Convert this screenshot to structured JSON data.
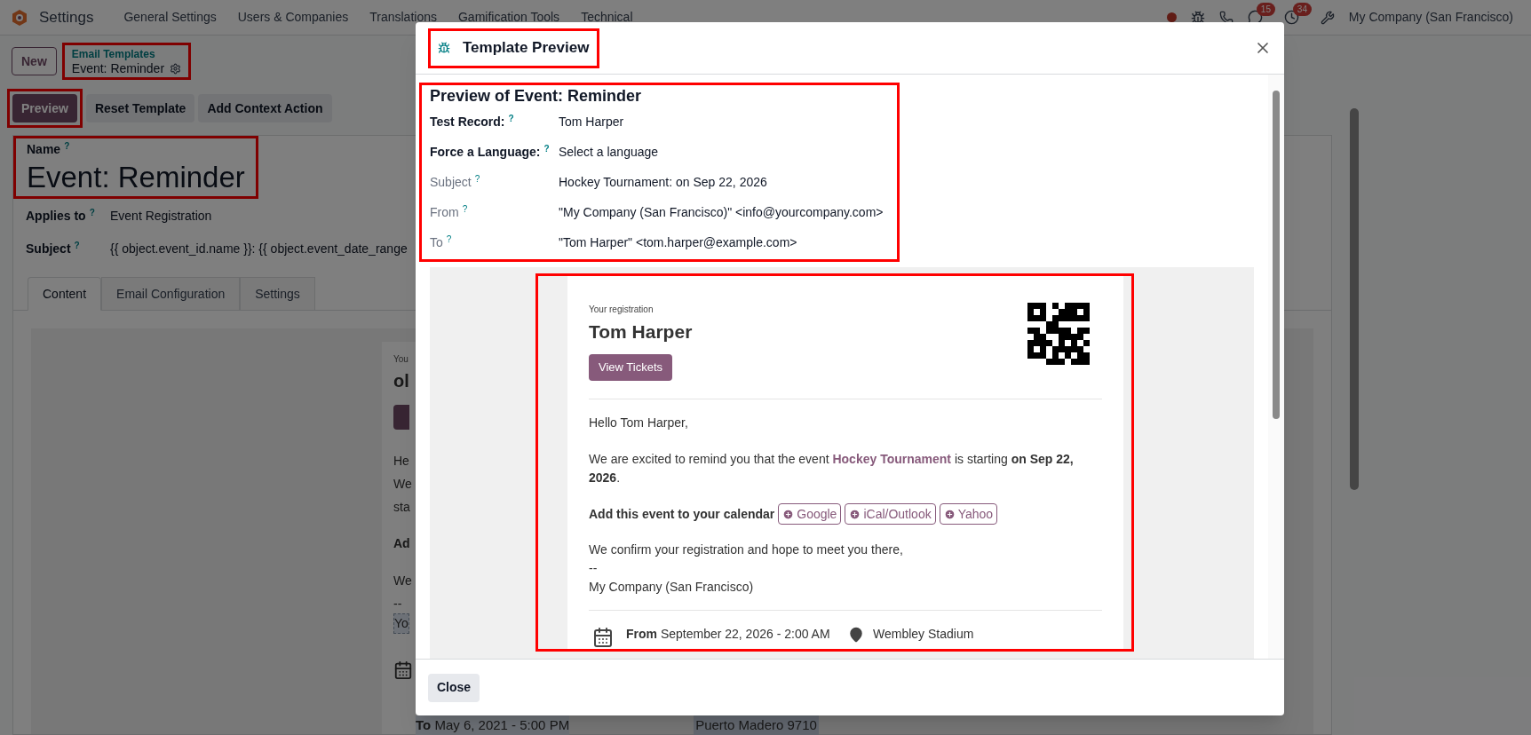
{
  "navbar": {
    "app": "Settings",
    "menu": [
      "General Settings",
      "Users & Companies",
      "Translations",
      "Gamification Tools",
      "Technical"
    ],
    "badges": [
      {
        "kind": "chat",
        "count": "15"
      },
      {
        "kind": "activity",
        "count": "34"
      }
    ],
    "company": "My Company (San Francisco)"
  },
  "control_panel": {
    "new_button": "New",
    "breadcrumb": {
      "parent": "Email Templates",
      "current": "Event: Reminder"
    },
    "buttons": [
      {
        "label": "Preview",
        "primary": true
      },
      {
        "label": "Reset Template",
        "primary": false
      },
      {
        "label": "Add Context Action",
        "primary": false
      }
    ]
  },
  "form": {
    "name_label": "Name",
    "name_help": "?",
    "name": "Event: Reminder",
    "fields": [
      {
        "label": "Applies to",
        "help": "?",
        "value": "Event Registration"
      },
      {
        "label": "Subject",
        "help": "?",
        "value": "{{ object.event_id.name }}: {{ object.event_date_range"
      }
    ],
    "tabs": [
      {
        "label": "Content",
        "selected": true
      },
      {
        "label": "Email Configuration",
        "selected": false
      },
      {
        "label": "Settings",
        "selected": false
      }
    ],
    "body_fragments": [
      {
        "kind": "small",
        "text": "You"
      },
      {
        "kind": "title",
        "text": "ol"
      },
      {
        "kind": "button"
      },
      {
        "kind": "text",
        "text": "He"
      },
      {
        "kind": "text",
        "text": "We"
      },
      {
        "kind": "text",
        "text": "sta"
      },
      {
        "kind": "bold",
        "text": "Ad"
      },
      {
        "kind": "text",
        "text": "We"
      },
      {
        "kind": "text",
        "text": "--"
      },
      {
        "kind": "highlight",
        "text": "Yo"
      }
    ],
    "bottom": {
      "date": "**To** May 6, 2021 - 5:00 PM",
      "location": "Puerto Madero 9710"
    }
  },
  "modal": {
    "title": "Template Preview",
    "heading": "Preview of Event: Reminder",
    "fields": [
      {
        "kind": "input",
        "label": "Test Record:",
        "help": "?",
        "value": "Tom Harper"
      },
      {
        "kind": "input",
        "label": "Force a Language:",
        "help": "?",
        "value": "Select a language"
      },
      {
        "kind": "readonly",
        "label": "Subject",
        "help": "?",
        "value": "Hockey Tournament: on Sep 22, 2026"
      },
      {
        "kind": "readonly",
        "label": "From",
        "help": "?",
        "value": "\"My Company (San Francisco)\" <info@yourcompany.com>"
      },
      {
        "kind": "readonly",
        "label": "To",
        "help": "?",
        "value": "\"Tom Harper\" <tom.harper@example.com>"
      }
    ],
    "email": {
      "kicker": "Your registration",
      "name": "Tom Harper",
      "button": "View Tickets",
      "greeting": "Hello Tom Harper,",
      "intro": {
        "before": "We are excited to remind you that the event ",
        "link": "Hockey Tournament",
        "after": " is starting **on Sep 22, 2026**."
      },
      "calendar": {
        "label": "Add this event to your calendar",
        "buttons": [
          "Google",
          "iCal/Outlook",
          "Yahoo"
        ]
      },
      "closing": [
        "We confirm your registration and hope to meet you there,",
        "--",
        "My Company (San Francisco)"
      ],
      "from": "**From** September 22, 2026 - 2:00 AM",
      "location": "Wembley Stadium"
    },
    "close_button": "Close"
  }
}
